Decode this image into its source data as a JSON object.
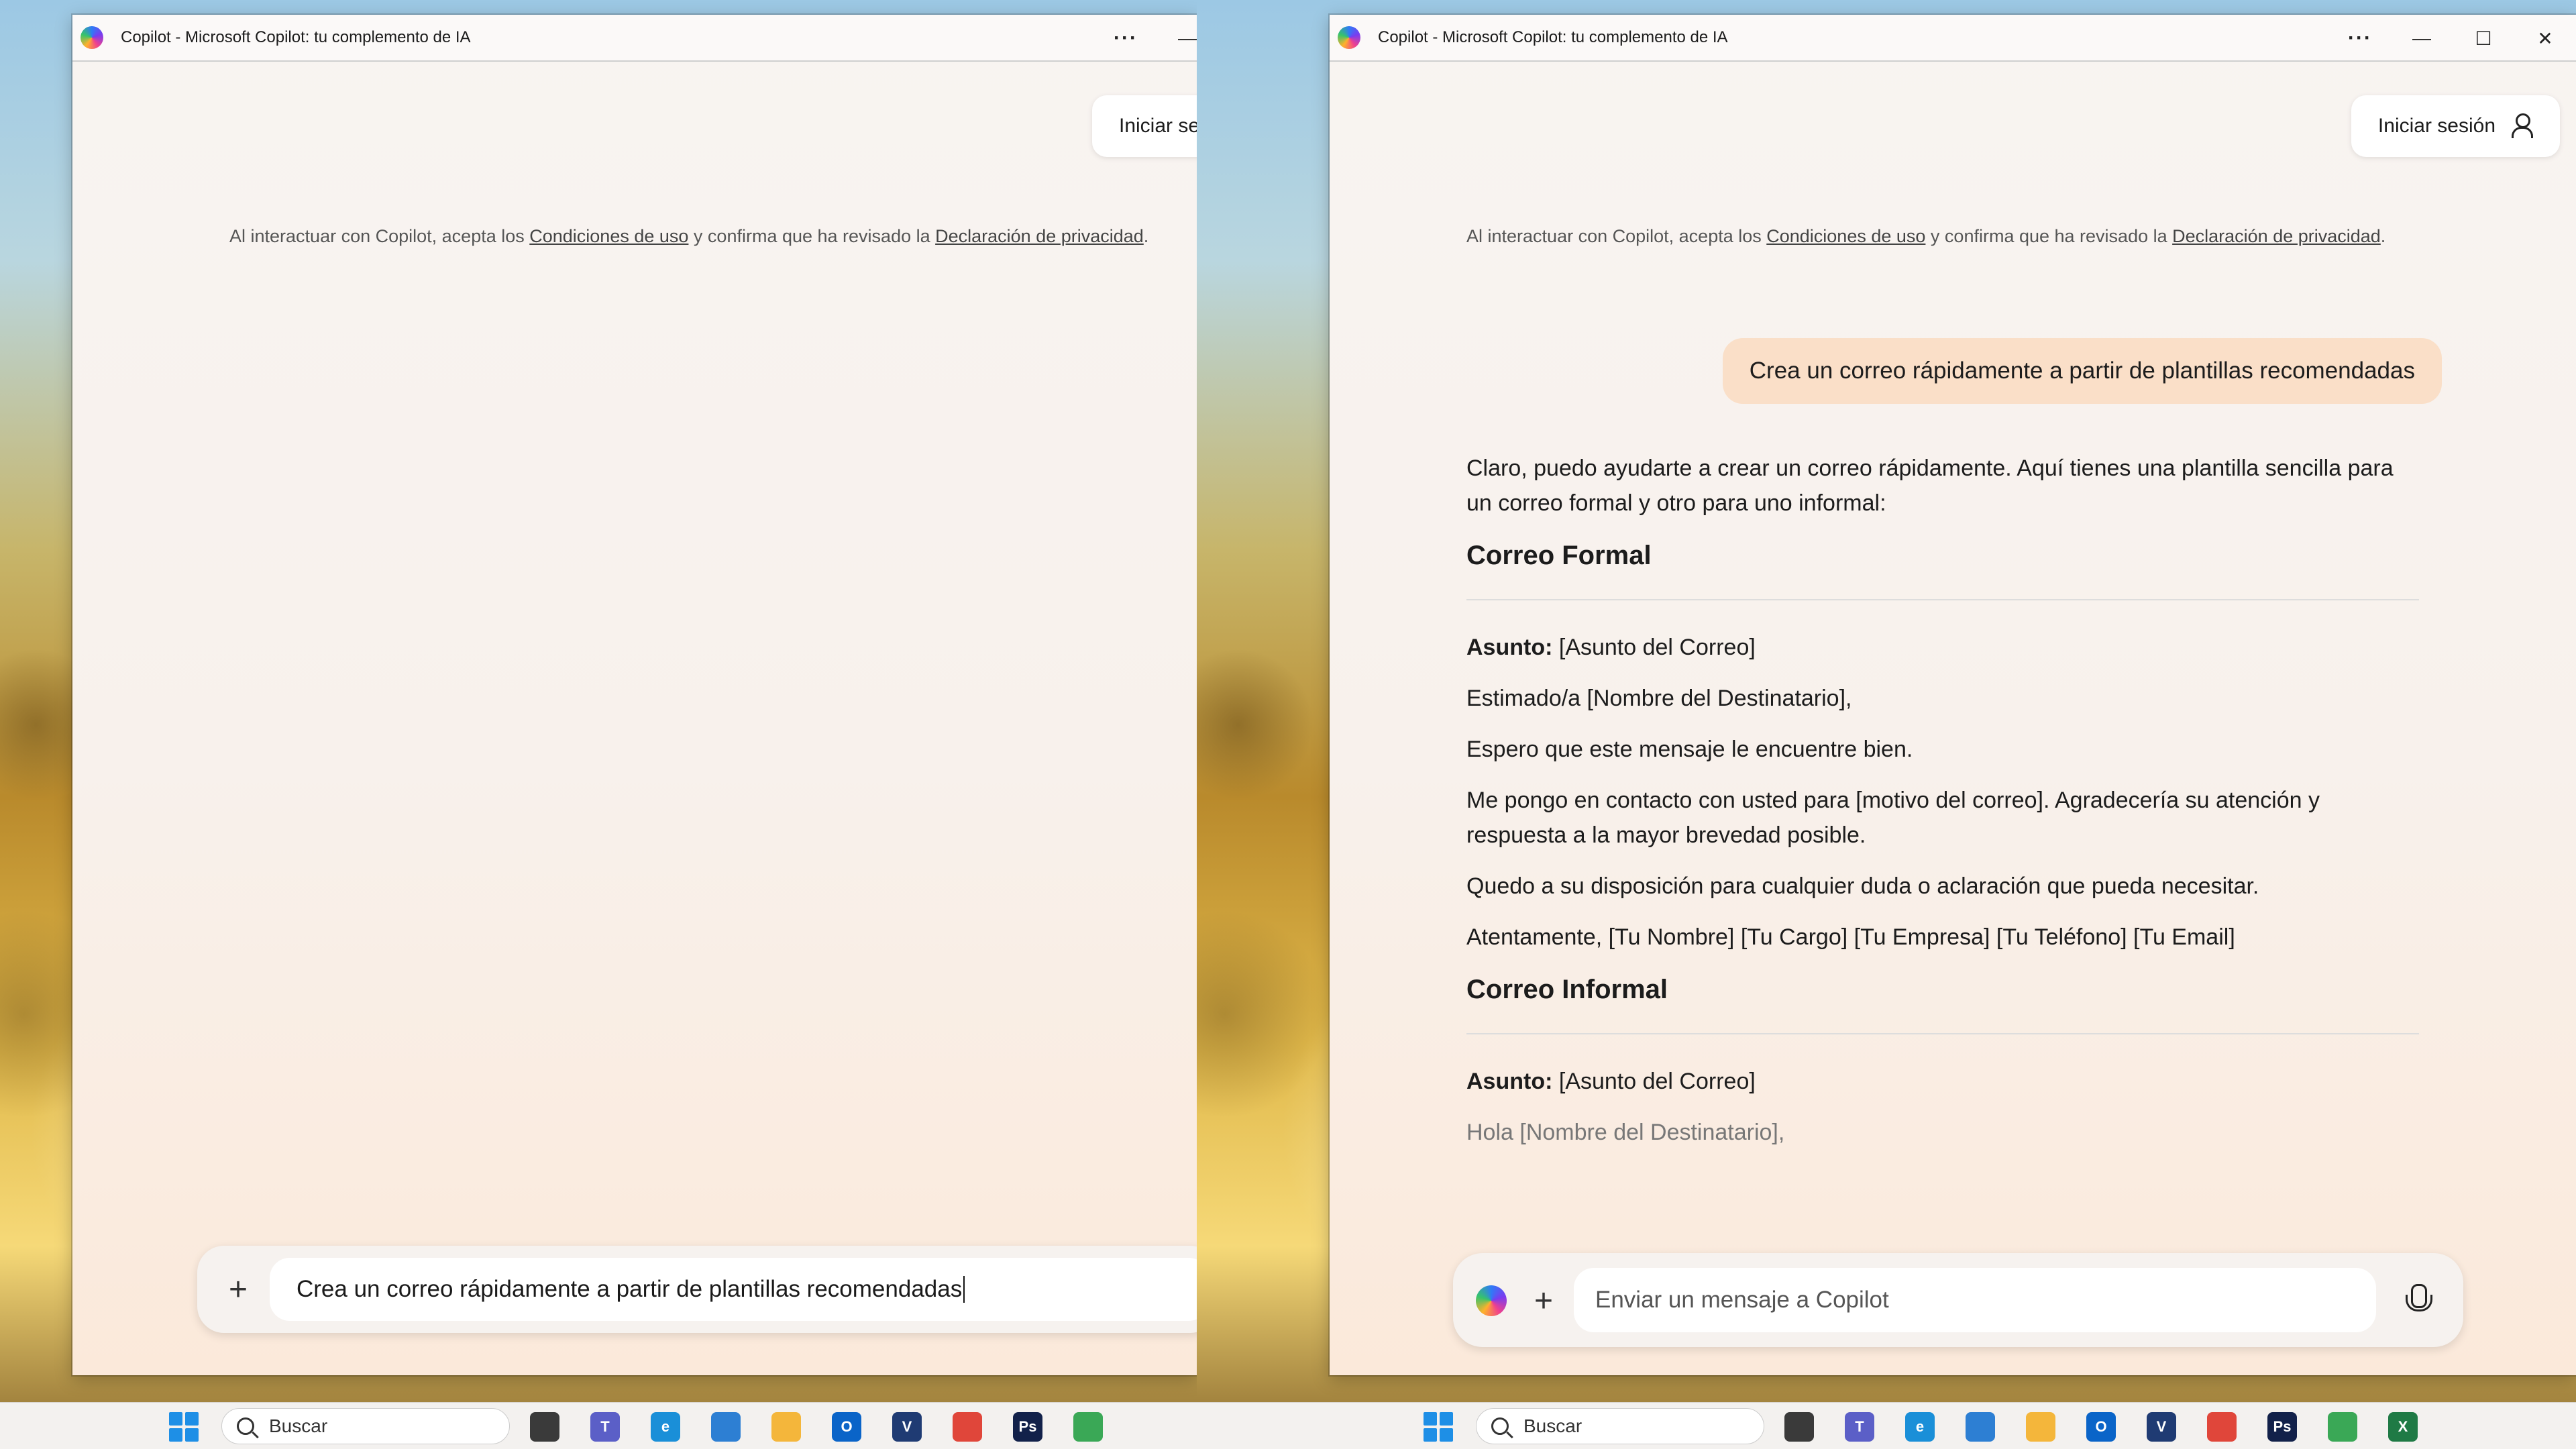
{
  "window": {
    "title": "Copilot - Microsoft Copilot: tu complemento de IA",
    "more_label": "···",
    "minimize_label": "—",
    "maximize_label": "☐",
    "close_label": "✕"
  },
  "signin": {
    "label_full": "Iniciar sesión",
    "label_clipped": "Iniciar se"
  },
  "terms": {
    "prefix": "Al interactuar con Copilot, acepta los ",
    "terms_link": "Condiciones de uso",
    "middle": " y confirma que ha revisado la ",
    "privacy_link": "Declaración de privacidad",
    "suffix": "."
  },
  "left_composer": {
    "input_value": "Crea un correo rápidamente a partir de plantillas recomendadas",
    "plus_label": "+",
    "send_label": "↑"
  },
  "chat": {
    "user_message": "Crea un correo rápidamente a partir de plantillas recomendadas",
    "intro": "Claro, puedo ayudarte a crear un correo rápidamente. Aquí tienes una plantilla sencilla para un correo formal y otro para uno informal:",
    "formal_heading": "Correo Formal",
    "asunto_label": "Asunto:",
    "asunto_value": " [Asunto del Correo]",
    "formal_greeting": "Estimado/a [Nombre del Destinatario],",
    "formal_line1": "Espero que este mensaje le encuentre bien.",
    "formal_line2": "Me pongo en contacto con usted para [motivo del correo]. Agradecería su atención y respuesta a la mayor brevedad posible.",
    "formal_line3": "Quedo a su disposición para cualquier duda o aclaración que pueda necesitar.",
    "formal_closing": "Atentamente, [Tu Nombre] [Tu Cargo] [Tu Empresa] [Tu Teléfono] [Tu Email]",
    "informal_heading": "Correo Informal",
    "informal_asunto_value": " [Asunto del Correo]",
    "informal_greeting": "Hola [Nombre del Destinatario],"
  },
  "right_composer": {
    "placeholder": "Enviar un mensaje a Copilot",
    "plus_label": "+"
  },
  "taskbar": {
    "search_label": "Buscar",
    "apps": [
      {
        "name": "file-explorer-icon",
        "glyph": "",
        "color": "#f4b63b"
      },
      {
        "name": "teams-icon",
        "glyph": "T",
        "color": "#5b5fc7"
      },
      {
        "name": "edge-icon",
        "glyph": "e",
        "color": "#1a8fd8"
      },
      {
        "name": "store-icon",
        "glyph": "",
        "color": "#2d7fd3"
      },
      {
        "name": "outlook-icon",
        "glyph": "O",
        "color": "#0a64c8"
      },
      {
        "name": "visio-icon",
        "glyph": "V",
        "color": "#1f3b73"
      },
      {
        "name": "chrome-icon",
        "glyph": "",
        "color": "#e0463a"
      },
      {
        "name": "photoshop-icon",
        "glyph": "Ps",
        "color": "#12214a"
      },
      {
        "name": "chrome-alt-icon",
        "glyph": "",
        "color": "#3aa856"
      }
    ],
    "excel_glyph": "X",
    "excel_color": "#1f7a45"
  }
}
